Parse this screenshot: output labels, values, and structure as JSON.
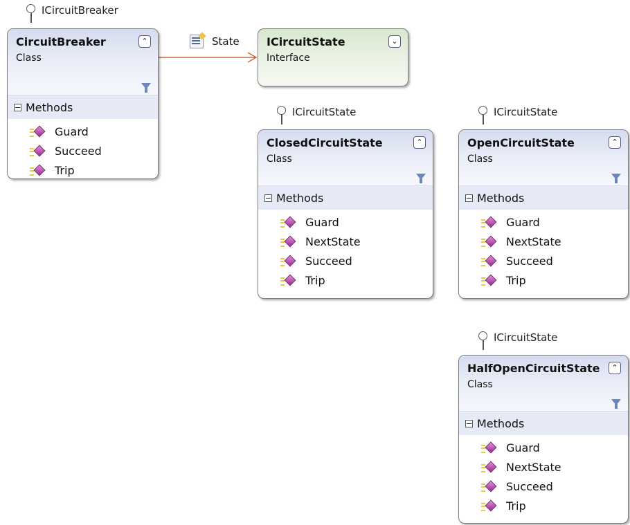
{
  "association": {
    "label": "State",
    "icon": "property-icon"
  },
  "boxes": {
    "circuit_breaker": {
      "interface": "ICircuitBreaker",
      "title": "CircuitBreaker",
      "kind": "Class",
      "section": "Methods",
      "methods": [
        "Guard",
        "Succeed",
        "Trip"
      ]
    },
    "icircuit_state": {
      "title": "ICircuitState",
      "kind": "Interface"
    },
    "closed": {
      "interface": "ICircuitState",
      "title": "ClosedCircuitState",
      "kind": "Class",
      "section": "Methods",
      "methods": [
        "Guard",
        "NextState",
        "Succeed",
        "Trip"
      ]
    },
    "open": {
      "interface": "ICircuitState",
      "title": "OpenCircuitState",
      "kind": "Class",
      "section": "Methods",
      "methods": [
        "Guard",
        "NextState",
        "Succeed",
        "Trip"
      ]
    },
    "half_open": {
      "interface": "ICircuitState",
      "title": "HalfOpenCircuitState",
      "kind": "Class",
      "section": "Methods",
      "methods": [
        "Guard",
        "NextState",
        "Succeed",
        "Trip"
      ]
    }
  },
  "colors": {
    "class_header": "#dfe5f4",
    "interface_header": "#e3eedb",
    "association_line": "#c8663d",
    "method_icon": "#b045a8"
  }
}
